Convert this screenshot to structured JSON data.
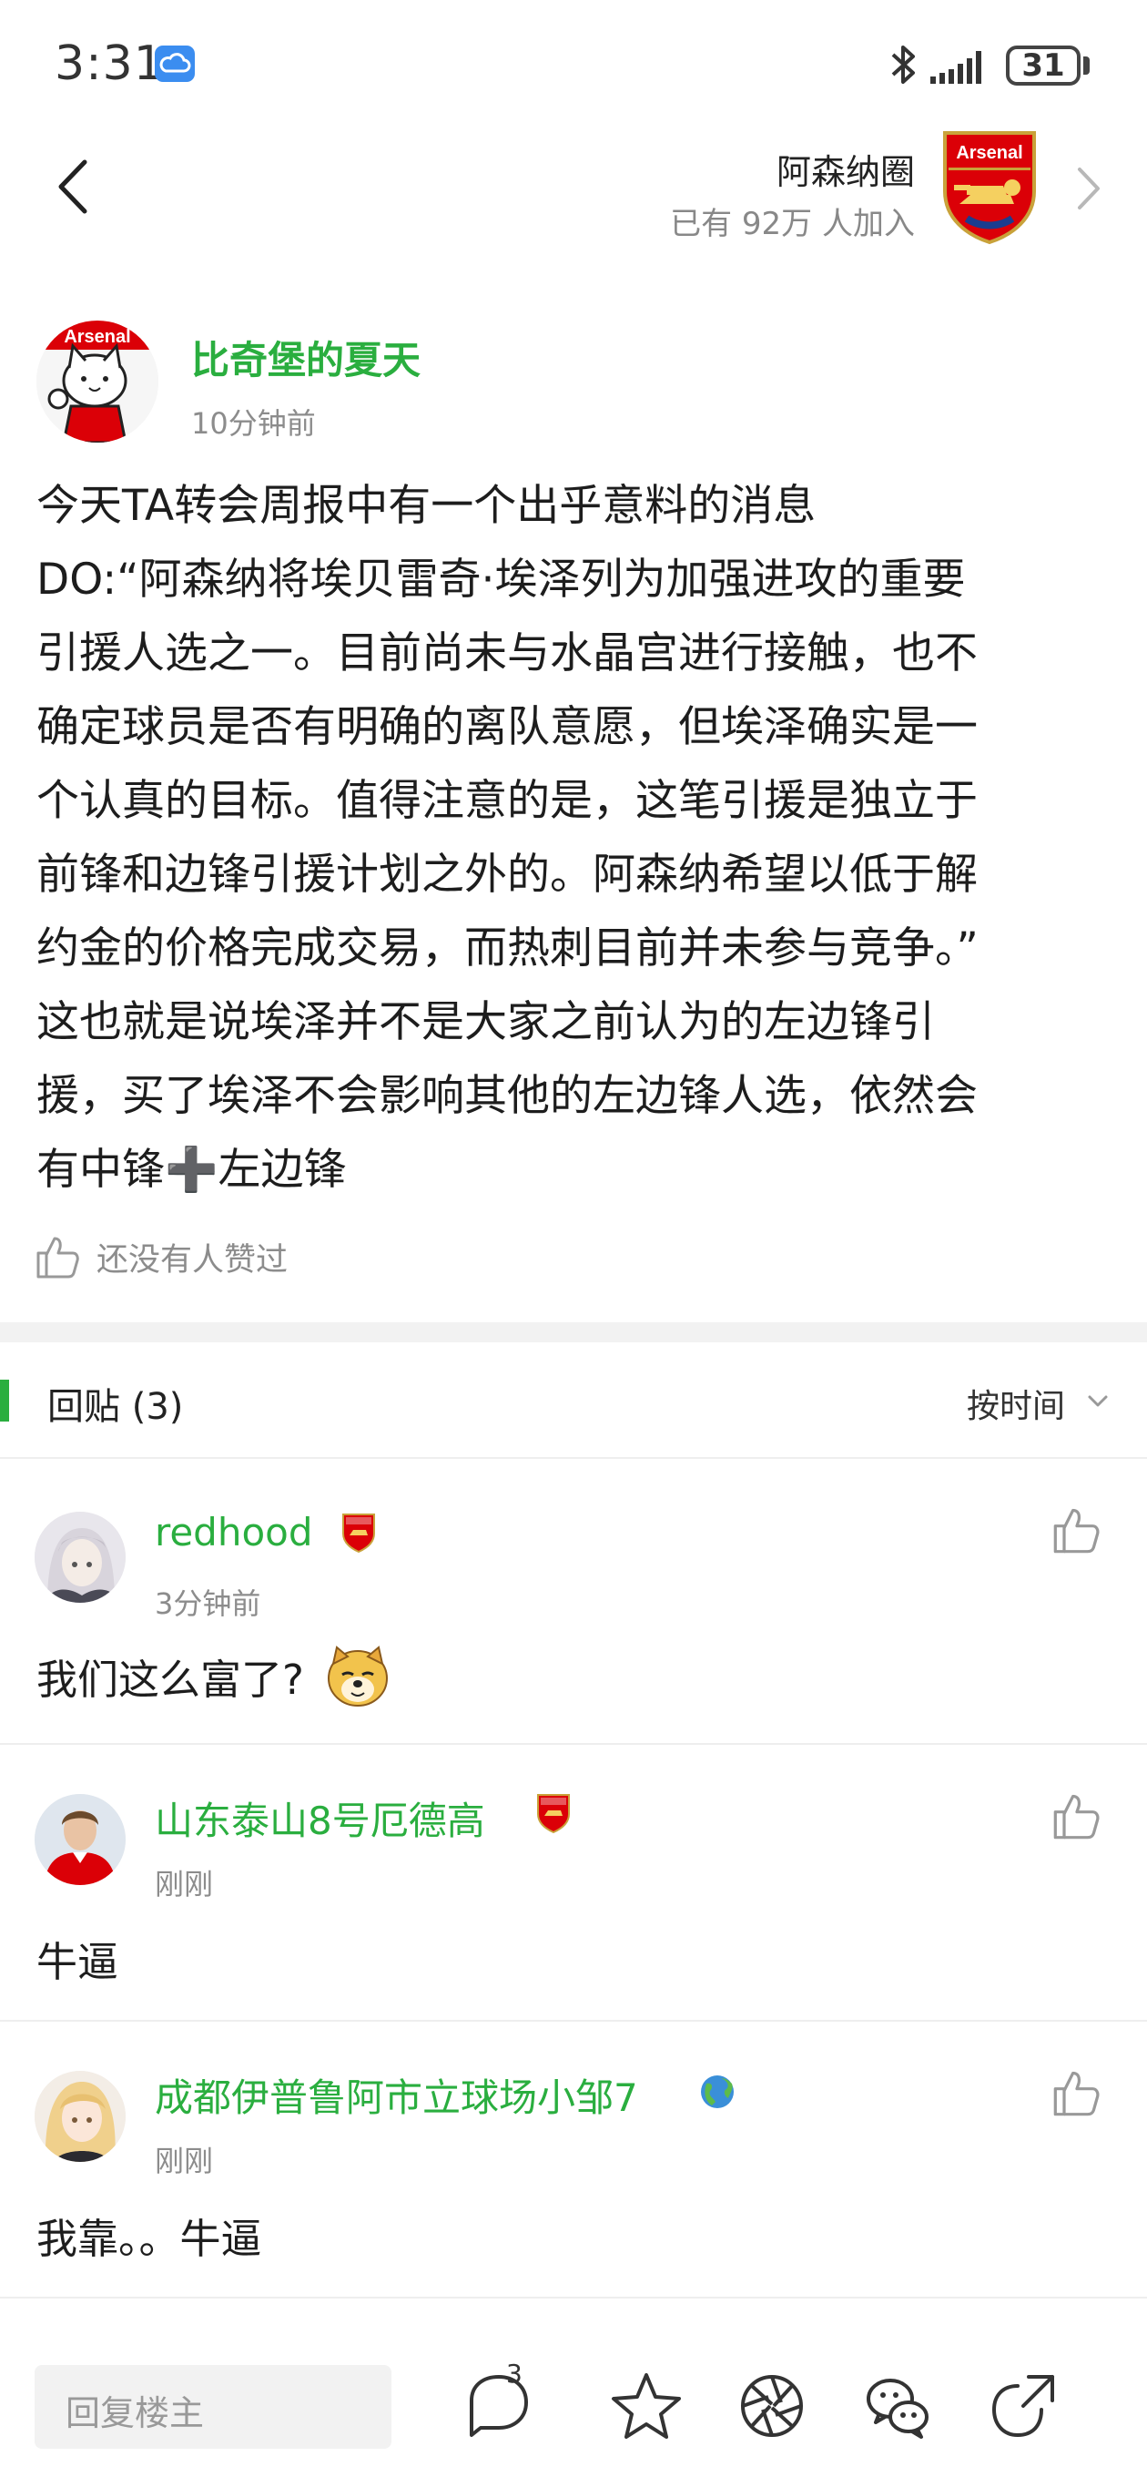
{
  "status_bar": {
    "time": "3:31",
    "battery": "31",
    "icons": [
      "cloud-icon",
      "bluetooth-icon",
      "signal-icon",
      "battery-icon"
    ]
  },
  "header": {
    "circle_name": "阿森纳圈",
    "members": "已有 92万 人加入",
    "logo_text": "Arsenal",
    "icons": [
      "back-icon",
      "arsenal-logo",
      "chevron-right-icon"
    ]
  },
  "post": {
    "avatar_text": "Arsenal",
    "author": "比奇堡的夏天",
    "time": "10分钟前",
    "body": "今天TA转会周报中有一个出乎意料的消息\nDO:“阿森纳将埃贝雷奇·埃泽列为加强进攻的重要\n引援人选之一。目前尚未与水晶宫进行接触，也不\n确定球员是否有明确的离队意愿，但埃泽确实是一\n个认真的目标。值得注意的是，这笔引援是独立于\n前锋和边锋引援计划之外的。阿森纳希望以低于解\n约金的价格完成交易，而热刺目前并未参与竞争。”\n这也就是说埃泽并不是大家之前认为的左边锋引\n援，买了埃泽不会影响其他的左边锋人选，依然会\n有中锋➕左边锋",
    "like_text": "还没有人赞过"
  },
  "replies": {
    "title": "回贴 (3)",
    "sort": "按时间",
    "items": [
      {
        "name": "redhood",
        "time": "3分钟前",
        "text": "我们这么富了?",
        "badge": "arsenal-badge-icon",
        "emoji": "doge-emoji"
      },
      {
        "name": "山东泰山8号厄德高",
        "time": "刚刚",
        "text": "牛逼",
        "badge": "arsenal-badge-icon"
      },
      {
        "name": "成都伊普鲁阿市立球场小邹7",
        "time": "刚刚",
        "text": "我靠。。牛逼",
        "badge": "globe-icon"
      }
    ]
  },
  "bottom_bar": {
    "reply_placeholder": "回复楼主",
    "comment_count": "3",
    "icons": [
      "comment-icon",
      "star-icon",
      "moments-icon",
      "wechat-icon",
      "share-icon"
    ]
  },
  "colors": {
    "accent_green": "#2aae3f",
    "arsenal_red": "#db0007",
    "text_secondary": "#8c8c8c"
  }
}
